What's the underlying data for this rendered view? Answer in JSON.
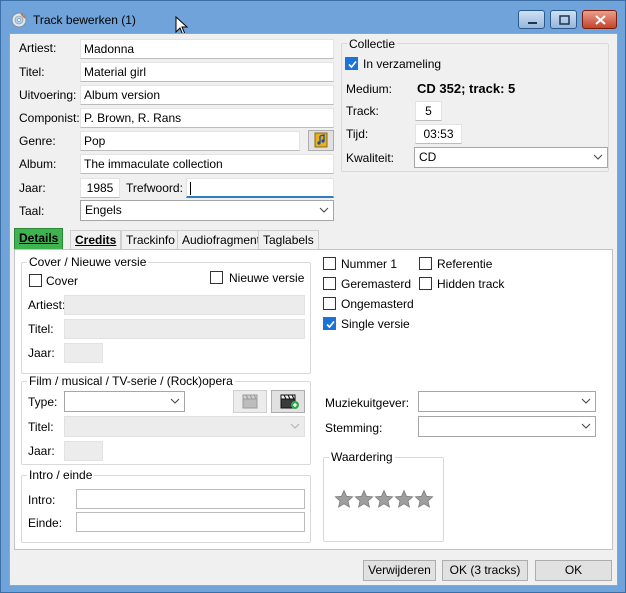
{
  "window": {
    "title": "Track bewerken (1)",
    "icons": {
      "app": "cd-disc-icon",
      "minimize": "minimize-icon",
      "maximize": "maximize-icon",
      "close": "close-icon"
    }
  },
  "main_fields": {
    "artiest": {
      "label": "Artiest:",
      "value": "Madonna"
    },
    "titel": {
      "label": "Titel:",
      "value": "Material girl"
    },
    "uitvoering": {
      "label": "Uitvoering:",
      "value": "Album version"
    },
    "componist": {
      "label": "Componist:",
      "value": "P. Brown, R. Rans"
    },
    "genre": {
      "label": "Genre:",
      "value": "Pop"
    },
    "album": {
      "label": "Album:",
      "value": "The immaculate collection"
    },
    "jaar": {
      "label": "Jaar:",
      "value": "1985"
    },
    "trefwoord": {
      "label": "Trefwoord:",
      "value": ""
    },
    "taal": {
      "label": "Taal:",
      "value": "Engels"
    }
  },
  "collectie": {
    "title": "Collectie",
    "in_verzameling": {
      "label": "In verzameling",
      "checked": true
    },
    "medium": {
      "label": "Medium:",
      "value": "CD 352; track: 5"
    },
    "track": {
      "label": "Track:",
      "value": "5"
    },
    "tijd": {
      "label": "Tijd:",
      "value": "03:53"
    },
    "kwaliteit": {
      "label": "Kwaliteit:",
      "value": "CD"
    }
  },
  "tabs": [
    {
      "label": "Details",
      "active": true
    },
    {
      "label": "Credits",
      "active": false
    },
    {
      "label": "Trackinfo",
      "active": false
    },
    {
      "label": "Audiofragment",
      "active": false
    },
    {
      "label": "Taglabels",
      "active": false
    }
  ],
  "details": {
    "cover_group": {
      "title": "Cover / Nieuwe versie",
      "cover": {
        "label": "Cover",
        "checked": false
      },
      "nieuwe_versie": {
        "label": "Nieuwe versie",
        "checked": false
      },
      "artiest_label": "Artiest:",
      "titel_label": "Titel:",
      "jaar_label": "Jaar:"
    },
    "film_group": {
      "title": "Film / musical / TV-serie / (Rock)opera",
      "type_label": "Type:",
      "titel_label": "Titel:",
      "jaar_label": "Jaar:"
    },
    "intro_group": {
      "title": "Intro / einde",
      "intro_label": "Intro:",
      "einde_label": "Einde:"
    },
    "checks": [
      {
        "label": "Nummer 1",
        "checked": false
      },
      {
        "label": "Geremasterd",
        "checked": false
      },
      {
        "label": "Ongemasterd",
        "checked": false
      },
      {
        "label": "Single versie",
        "checked": true
      },
      {
        "label": "Referentie",
        "checked": false
      },
      {
        "label": "Hidden track",
        "checked": false
      }
    ],
    "muziekuitgever_label": "Muziekuitgever:",
    "stemming_label": "Stemming:",
    "waardering": {
      "title": "Waardering",
      "stars": 0,
      "max": 5
    }
  },
  "buttons": {
    "verwijderen": "Verwijderen",
    "ok_all": "OK (3 tracks)",
    "ok": "OK"
  },
  "colors": {
    "active_tab": "#3fb34f",
    "checkbox_checked": "#1a73d9",
    "titlebar": "#6fa3d9"
  }
}
